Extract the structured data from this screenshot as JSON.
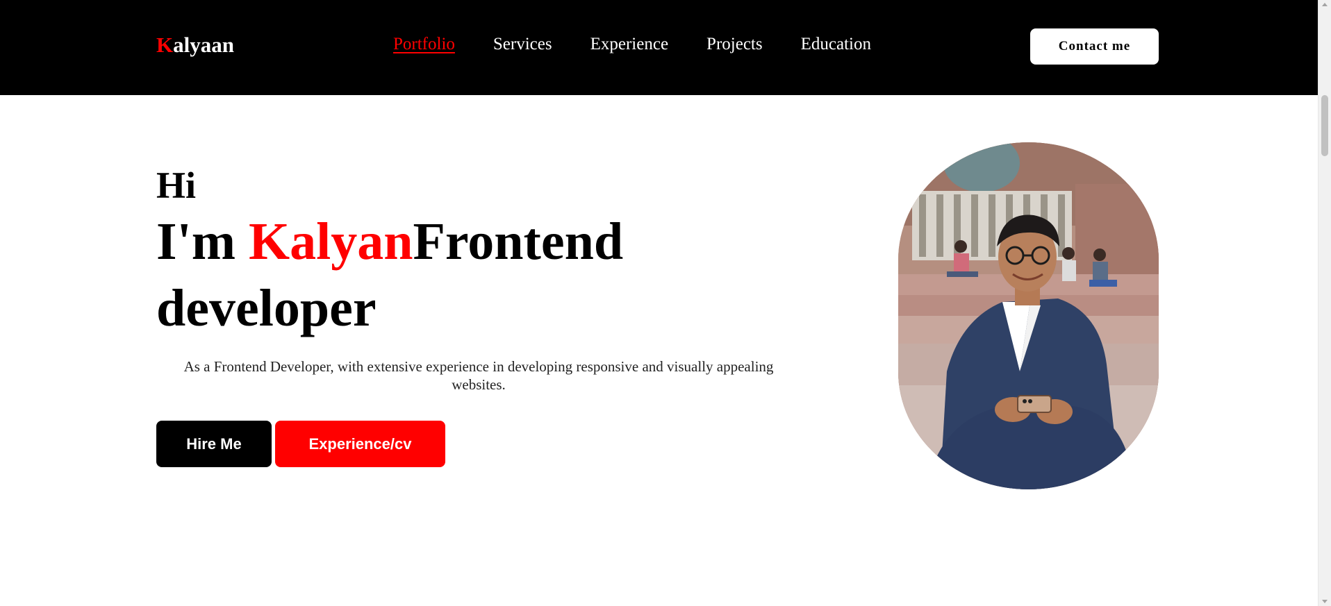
{
  "nav": {
    "logo_first": "K",
    "logo_rest": "alyaan",
    "links": [
      {
        "label": "Portfolio",
        "active": true
      },
      {
        "label": "Services",
        "active": false
      },
      {
        "label": "Experience",
        "active": false
      },
      {
        "label": "Projects",
        "active": false
      },
      {
        "label": "Education",
        "active": false
      }
    ],
    "contact_label": "Contact me"
  },
  "hero": {
    "greeting": "Hi",
    "title_prefix": "I'm ",
    "name": "Kalyan",
    "title_suffix": "Frontend developer",
    "description": "As a Frontend Developer, with extensive experience in developing responsive and visually appealing websites.",
    "hire_label": "Hire Me",
    "cv_label": "Experience/cv"
  },
  "colors": {
    "accent": "#ff0000",
    "nav_bg": "#000000",
    "text": "#000000"
  }
}
